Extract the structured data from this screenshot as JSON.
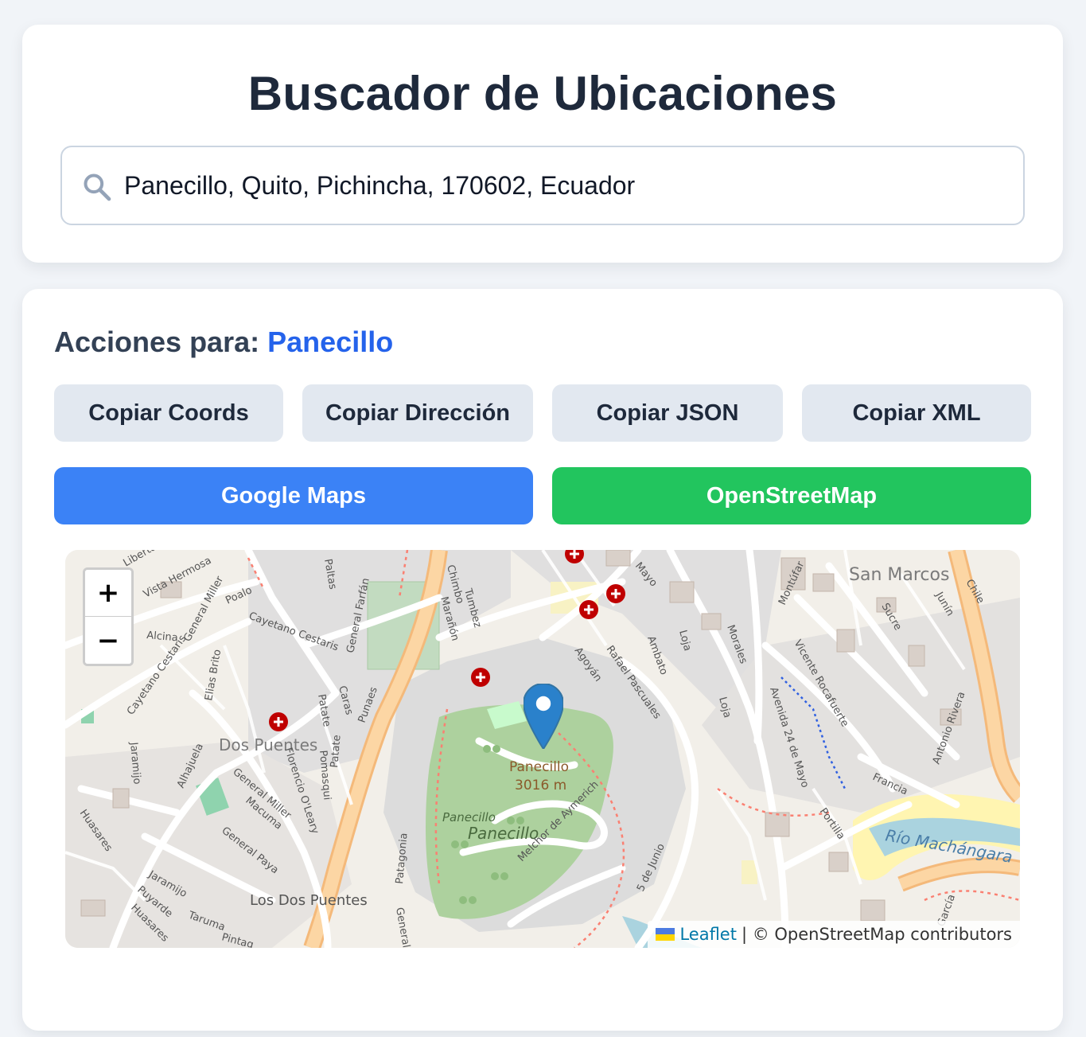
{
  "search": {
    "title": "Buscador de Ubicaciones",
    "value": "Panecillo, Quito, Pichincha, 170602, Ecuador",
    "icon": "search-icon"
  },
  "actions": {
    "heading_prefix": "Acciones para:",
    "place_name": "Panecillo",
    "copy_buttons": [
      {
        "label": "Copiar Coords"
      },
      {
        "label": "Copiar Dirección"
      },
      {
        "label": "Copiar JSON"
      },
      {
        "label": "Copiar XML"
      }
    ],
    "google_maps_label": "Google Maps",
    "osm_label": "OpenStreetMap"
  },
  "map": {
    "zoom_in": "+",
    "zoom_out": "−",
    "attribution_link": "Leaflet",
    "attribution_text": "| © OpenStreetMap contributors",
    "labels": {
      "san_marcos": "San Marcos",
      "dos_puentes": "Dos Puentes",
      "los_dos_puentes": "Los Dos Puentes",
      "panecillo_peak": "Panecillo",
      "panecillo_elev": "3016 m",
      "panecillo_area": "Panecillo",
      "panecillo_small": "Panecillo",
      "rio": "Río Machángara",
      "streets": {
        "liberta": "Liberta",
        "vista_hermosa": "Vista Hermosa",
        "general_miller_top": "General Miller",
        "poalo": "Poalo",
        "alcina": "Alcina",
        "cayetano_cestaris_1": "Cayetano Cestaris",
        "cayetano_cestaris_2": "Cayetano Cestaris",
        "paltas": "Paltas",
        "general_farfan": "General Farfán",
        "chimbo": "Chimbo",
        "maranon": "Marañón",
        "tumbez": "Tumbez",
        "mayo": "Mayo",
        "elias_brito": "Elias Brito",
        "patate_1": "Patate",
        "caras": "Caras",
        "punaes": "Punaes",
        "agoyan": "Agoyán",
        "rafael_pascuales": "Rafael Pascuales",
        "ambato": "Ambato",
        "loja_1": "Loja",
        "loja_2": "Loja",
        "morales": "Morales",
        "montufar": "Montúfar",
        "sucre": "Sucre",
        "junin": "Junín",
        "chile": "Chile",
        "vicente_rocafuerte": "Vicente Rocafuerte",
        "avenida_24_mayo": "Avenida 24 de Mayo",
        "antonio_rivera": "Antonio Rivera",
        "francia": "Francia",
        "portilla": "Portilla",
        "jaramijo_1": "Jaramijo",
        "alhajuela": "Alhajuela",
        "florencio_oleary": "Florencio O'Leary",
        "pomasqui": "Pomasqui",
        "patate_2": "Patate",
        "general_miller": "General Miller",
        "macuma": "Macuma",
        "general_paya": "General Paya",
        "huasares_1": "Huasares",
        "huasares_2": "Huasares",
        "jaramijo_2": "Jaramijo",
        "puyarde": "Puyarde",
        "taruma": "Taruma",
        "pintag": "Pintag",
        "patagonia": "Patagonia",
        "general": "General",
        "melchor": "Melchor de Aymerich",
        "cinco_junio": "5 de Junio",
        "garcia": "García"
      }
    }
  },
  "colors": {
    "accent_blue": "#2563eb",
    "google_btn": "#3b82f6",
    "osm_btn": "#22c55e",
    "gray_btn": "#e2e8f0",
    "marker_blue": "#2a81cb"
  }
}
